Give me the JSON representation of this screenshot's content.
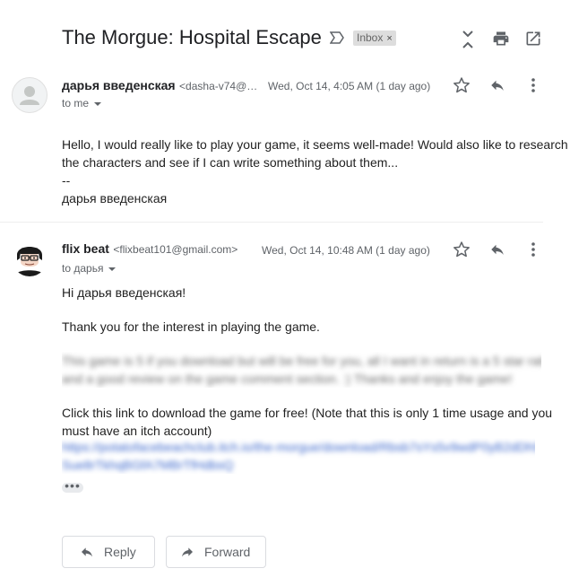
{
  "thread": {
    "subject": "The Morgue: Hospital Escape",
    "label": "Inbox",
    "label_close": "×"
  },
  "messages": [
    {
      "sender_name": "дарья введенская",
      "sender_email": "<dasha-v74@…",
      "date": "Wed, Oct 14, 4:05 AM (1 day ago)",
      "to": "to me",
      "body_lines": [
        "Hello, I would really like to play your game, it seems well-made! Would also like to research",
        "the characters and see if I can write something about them...",
        "--",
        "дарья введенская"
      ]
    },
    {
      "sender_name": "flix beat",
      "sender_email": "<flixbeat101@gmail.com>",
      "date": "Wed, Oct 14, 10:48 AM (1 day ago)",
      "to": "to дарья",
      "greeting": "Hi дарья введенская!",
      "thanks": "Thank you for the interest in playing the game.",
      "blurred_lines": [
        "This game is 5 if you download but will be free for you, all I want in return is a 5 star rating",
        "and a good review on the game comment section. :) Thanks and enjoy the game!"
      ],
      "download_lines": [
        "Click this link to download the game for free! (Note that this is only 1 time usage and you",
        "must have an itch account)"
      ],
      "link_lines": [
        "https://potatofacebeachclub.itch.io/the-morgue/download/Rbsb7sYs5v9wdP0yB2dDh9jeB7T73",
        "Sue8rTkhqBGfA7MBrTfHdbsQ"
      ],
      "ellipsis": "•••"
    }
  ],
  "actions": {
    "reply_label": "Reply",
    "forward_label": "Forward"
  },
  "colors": {
    "star": "#5f6368",
    "link": "#1a73e8",
    "chip_bg": "#dddddd"
  }
}
